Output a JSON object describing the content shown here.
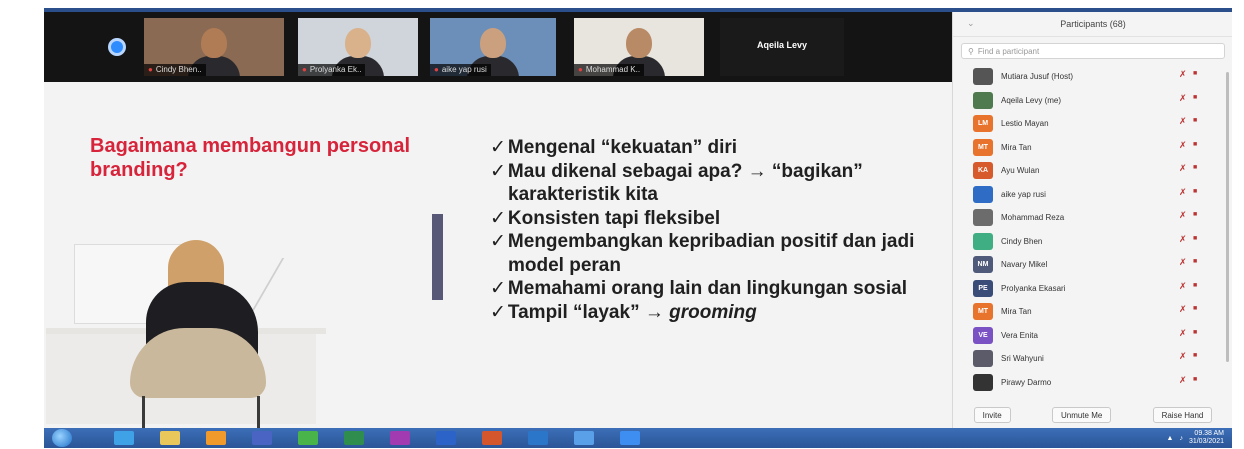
{
  "video_strip": {
    "tiles": [
      {
        "name": "Cindy Bhen..",
        "skin": "#b07c55",
        "bg": "#8a6a52",
        "muted": true
      },
      {
        "name": "Prolyanka Ek..",
        "skin": "#d9b28c",
        "bg": "#cfd5da",
        "muted": true
      },
      {
        "name": "aike yap rusi",
        "skin": "#caa07e",
        "bg": "#6b8fb8",
        "muted": true
      },
      {
        "name": "Mohammad K..",
        "skin": "#b98a66",
        "bg": "#e8e4de",
        "muted": true
      }
    ],
    "blank_tile_label": "Aqeila Levy"
  },
  "slide": {
    "title": "Bagaimana membangun personal branding?",
    "bullets": [
      {
        "text": "Mengenal “kekuatan” diri"
      },
      {
        "text": "Mau dikenal sebagai apa? → “bagikan” karakteristik kita"
      },
      {
        "text": "Konsisten tapi fleksibel"
      },
      {
        "text": "Mengembangkan kepribadian positif dan jadi model peran"
      },
      {
        "text": "Memahami orang lain dan lingkungan sosial"
      },
      {
        "text": "Tampil “layak” → ",
        "italic": "grooming"
      }
    ]
  },
  "participants": {
    "title": "Participants (68)",
    "search_placeholder": "Find a participant",
    "list": [
      {
        "initials": "",
        "color": "#555555",
        "name": "Mutiara Jusuf (Host)"
      },
      {
        "initials": "",
        "color": "#4f7a4f",
        "name": "Aqeila Levy (me)"
      },
      {
        "initials": "LM",
        "color": "#e8732c",
        "name": "Lestio Mayan"
      },
      {
        "initials": "MT",
        "color": "#e8732c",
        "name": "Mira Tan"
      },
      {
        "initials": "KA",
        "color": "#d65a2c",
        "name": "Ayu Wulan"
      },
      {
        "initials": "",
        "color": "#2f6cc6",
        "name": "aike yap rusi"
      },
      {
        "initials": "",
        "color": "#6c6c6c",
        "name": "Mohammad Reza"
      },
      {
        "initials": "",
        "color": "#3fae83",
        "name": "Cindy Bhen"
      },
      {
        "initials": "NM",
        "color": "#4f5a7a",
        "name": "Navary Mikel"
      },
      {
        "initials": "PE",
        "color": "#3a4c78",
        "name": "Prolyanka Ekasari"
      },
      {
        "initials": "MT",
        "color": "#e8732c",
        "name": "Mira Tan"
      },
      {
        "initials": "VE",
        "color": "#7a52c4",
        "name": "Vera Enita"
      },
      {
        "initials": "",
        "color": "#5b5b6a",
        "name": "Sri Wahyuni"
      },
      {
        "initials": "",
        "color": "#333333",
        "name": "Pirawy Darmo"
      }
    ],
    "footer_buttons": [
      "Invite",
      "Unmute Me",
      "Raise Hand"
    ]
  },
  "taskbar": {
    "icons": [
      {
        "name": "ie-icon",
        "color": "#3fa2e6"
      },
      {
        "name": "folder-icon",
        "color": "#e9c75a"
      },
      {
        "name": "media-icon",
        "color": "#f19a2c"
      },
      {
        "name": "player-icon",
        "color": "#4a64c4"
      },
      {
        "name": "chrome-icon",
        "color": "#49b449"
      },
      {
        "name": "excel-icon",
        "color": "#2f8d4e"
      },
      {
        "name": "onenote-icon",
        "color": "#a23bb1"
      },
      {
        "name": "word-icon",
        "color": "#2c63c9"
      },
      {
        "name": "powerpoint-icon",
        "color": "#d4562c"
      },
      {
        "name": "outlook-icon",
        "color": "#2b76c9"
      },
      {
        "name": "photos-icon",
        "color": "#5aa0e8"
      },
      {
        "name": "zoom-icon",
        "color": "#3e8ef2"
      }
    ],
    "time": "09.38 AM",
    "date": "31/03/2021"
  }
}
